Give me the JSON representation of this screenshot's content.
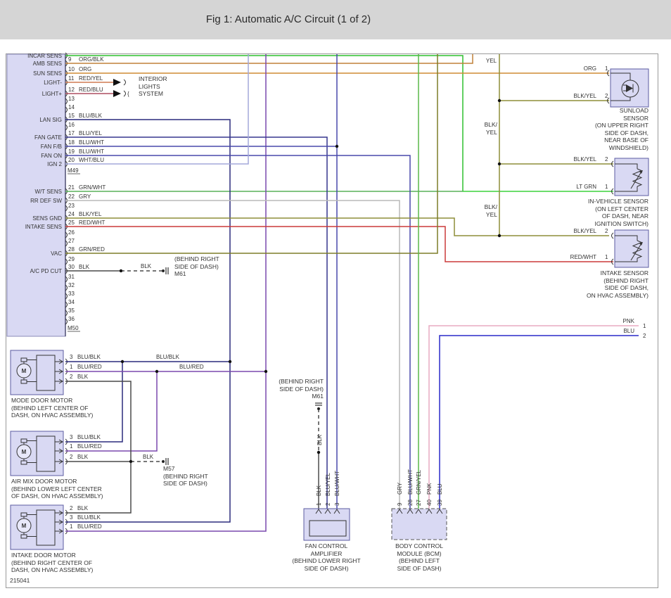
{
  "title": "Fig 1: Automatic A/C Circuit (1 of 2)",
  "figure_number": "215041",
  "colors": {
    "green": "#2ebf2e",
    "lt_grn": "#3bd23b",
    "grn_wht": "#58b058",
    "org": "#cf8c34",
    "org_blk": "#c08038",
    "red_yel": "#cf7a50",
    "red_blu": "#ad4f60",
    "blu_blk": "#2b2b7d",
    "blu_yel": "#36368e",
    "blu_wht": "#4848ac",
    "wht_blu": "#a3a8da",
    "gry": "#b9b9b9",
    "blk_yel": "#8e8e38",
    "red_wht": "#cc3a3a",
    "grn_red": "#7d7d28",
    "grn_yel": "#5ab84a",
    "pnk": "#e9aac2",
    "blu": "#2a2ac8",
    "blk": "#4a4a4a",
    "blu_red": "#7a49ad",
    "box_fill": "#d9d9f3"
  },
  "connector_m49": {
    "id": "M49",
    "rows": [
      {
        "pin": "",
        "wire": "",
        "signal": "INCAR SENS"
      },
      {
        "pin": "9",
        "wire": "ORG/BLK",
        "signal": "AMB SENS"
      },
      {
        "pin": "10",
        "wire": "ORG",
        "signal": "SUN SENS"
      },
      {
        "pin": "11",
        "wire": "RED/YEL",
        "signal": "LIGHT-"
      },
      {
        "pin": "12",
        "wire": "RED/BLU",
        "signal": "LIGHT+"
      },
      {
        "pin": "13",
        "wire": "",
        "signal": ""
      },
      {
        "pin": "14",
        "wire": "",
        "signal": ""
      },
      {
        "pin": "15",
        "wire": "BLU/BLK",
        "signal": "LAN SIG"
      },
      {
        "pin": "16",
        "wire": "",
        "signal": ""
      },
      {
        "pin": "17",
        "wire": "BLU/YEL",
        "signal": "FAN GATE"
      },
      {
        "pin": "18",
        "wire": "BLU/WHT",
        "signal": "FAN F/B"
      },
      {
        "pin": "19",
        "wire": "BLU/WHT",
        "signal": "FAN ON"
      },
      {
        "pin": "20",
        "wire": "WHT/BLU",
        "signal": "IGN 2"
      }
    ]
  },
  "connector_m50": {
    "id": "M50",
    "rows": [
      {
        "pin": "21",
        "wire": "GRN/WHT",
        "signal": "W/T SENS"
      },
      {
        "pin": "22",
        "wire": "GRY",
        "signal": "RR DEF SW"
      },
      {
        "pin": "23",
        "wire": "",
        "signal": ""
      },
      {
        "pin": "24",
        "wire": "BLK/YEL",
        "signal": "SENS GND"
      },
      {
        "pin": "25",
        "wire": "RED/WHT",
        "signal": "INTAKE SENS"
      },
      {
        "pin": "26",
        "wire": "",
        "signal": ""
      },
      {
        "pin": "27",
        "wire": "",
        "signal": ""
      },
      {
        "pin": "28",
        "wire": "GRN/RED",
        "signal": "VAC"
      },
      {
        "pin": "29",
        "wire": "",
        "signal": ""
      },
      {
        "pin": "30",
        "wire": "BLK",
        "signal": "A/C PD CUT"
      },
      {
        "pin": "31",
        "wire": "",
        "signal": ""
      },
      {
        "pin": "32",
        "wire": "",
        "signal": ""
      },
      {
        "pin": "33",
        "wire": "",
        "signal": ""
      },
      {
        "pin": "34",
        "wire": "",
        "signal": ""
      },
      {
        "pin": "35",
        "wire": "",
        "signal": ""
      },
      {
        "pin": "36",
        "wire": "",
        "signal": ""
      }
    ]
  },
  "interior_lights": {
    "caption": "INTERIOR\nLIGHTS\nSYSTEM"
  },
  "top_labels": {
    "yel": "YEL",
    "blk_yel_stack": "BLK/\nYEL"
  },
  "sunload_sensor": {
    "pin1_wire": "ORG",
    "pin1": "1",
    "pin2_wire": "BLK/YEL",
    "pin2": "2",
    "caption": "SUNLOAD\nSENSOR\n(ON UPPER RIGHT\nSIDE OF DASH,\nNEAR BASE OF\nWINDSHIELD)"
  },
  "in_vehicle_sensor": {
    "pin2_wire": "BLK/YEL",
    "pin2": "2",
    "pin1_wire": "LT GRN",
    "pin1": "1",
    "caption": "IN-VEHICLE SENSOR\n(ON LEFT CENTER\nOF DASH, NEAR\nIGNITION SWITCH)"
  },
  "intake_sensor": {
    "pin2_wire": "BLK/YEL",
    "pin2": "2",
    "pin1_wire": "RED/WHT",
    "pin1": "1",
    "caption": "INTAKE SENSOR\n(BEHIND RIGHT\nSIDE OF DASH,\nON HVAC ASSEMBLY)"
  },
  "mode_door_motor": {
    "symbol": "M",
    "pins": [
      {
        "num": "3",
        "wire": "BLU/BLK"
      },
      {
        "num": "1",
        "wire": "BLU/RED"
      },
      {
        "num": "2",
        "wire": "BLK"
      }
    ],
    "caption": "MODE DOOR MOTOR\n(BEHIND LEFT CENTER OF\nDASH, ON HVAC ASSEMBLY)"
  },
  "air_mix_door_motor": {
    "symbol": "M",
    "pins": [
      {
        "num": "3",
        "wire": "BLU/BLK"
      },
      {
        "num": "1",
        "wire": "BLU/RED"
      },
      {
        "num": "2",
        "wire": "BLK"
      }
    ],
    "caption": "AIR MIX DOOR MOTOR\n(BEHIND LOWER LEFT CENTER\nOF DASH, ON HVAC ASSEMBLY)"
  },
  "intake_door_motor": {
    "symbol": "M",
    "pins": [
      {
        "num": "2",
        "wire": "BLK"
      },
      {
        "num": "3",
        "wire": "BLU/BLK"
      },
      {
        "num": "1",
        "wire": "BLU/RED"
      }
    ],
    "caption": "INTAKE DOOR MOTOR\n(BEHIND RIGHT CENTER OF\nDASH, ON HVAC ASSEMBLY)"
  },
  "wire_labels": {
    "blu_blk": "BLU/BLK",
    "blu_red": "BLU/RED",
    "blk": "BLK"
  },
  "m61_splice_a": {
    "wire": "BLK",
    "caption": "(BEHIND RIGHT\nSIDE OF DASH)\nM61"
  },
  "m61_splice_b": {
    "wire": "BLK",
    "caption": "(BEHIND RIGHT\nSIDE OF DASH)\nM61"
  },
  "m57_splice": {
    "caption": "M57\n(BEHIND RIGHT\nSIDE OF DASH)"
  },
  "fan_control_amplifier": {
    "pins": [
      {
        "num": "1",
        "wire": "BLK"
      },
      {
        "num": "2",
        "wire": "BLU/YEL"
      },
      {
        "num": "3",
        "wire": "BLU/WHT"
      }
    ],
    "caption": "FAN CONTROL\nAMPLIFIER\n(BEHIND LOWER RIGHT\nSIDE OF DASH)"
  },
  "bcm": {
    "pins": [
      {
        "num": "9",
        "wire": "GRY"
      },
      {
        "num": "28",
        "wire": "BLU/WHT"
      },
      {
        "num": "27",
        "wire": "GRN/YEL"
      },
      {
        "num": "40",
        "wire": "PNK"
      },
      {
        "num": "39",
        "wire": "BLU"
      }
    ],
    "caption": "BODY CONTROL\nMODULE (BCM)\n(BEHIND LEFT\nSIDE OF DASH)"
  },
  "page_connector": {
    "pnk": "PNK",
    "pnk_pin": "1",
    "blu": "BLU",
    "blu_pin": "2"
  }
}
